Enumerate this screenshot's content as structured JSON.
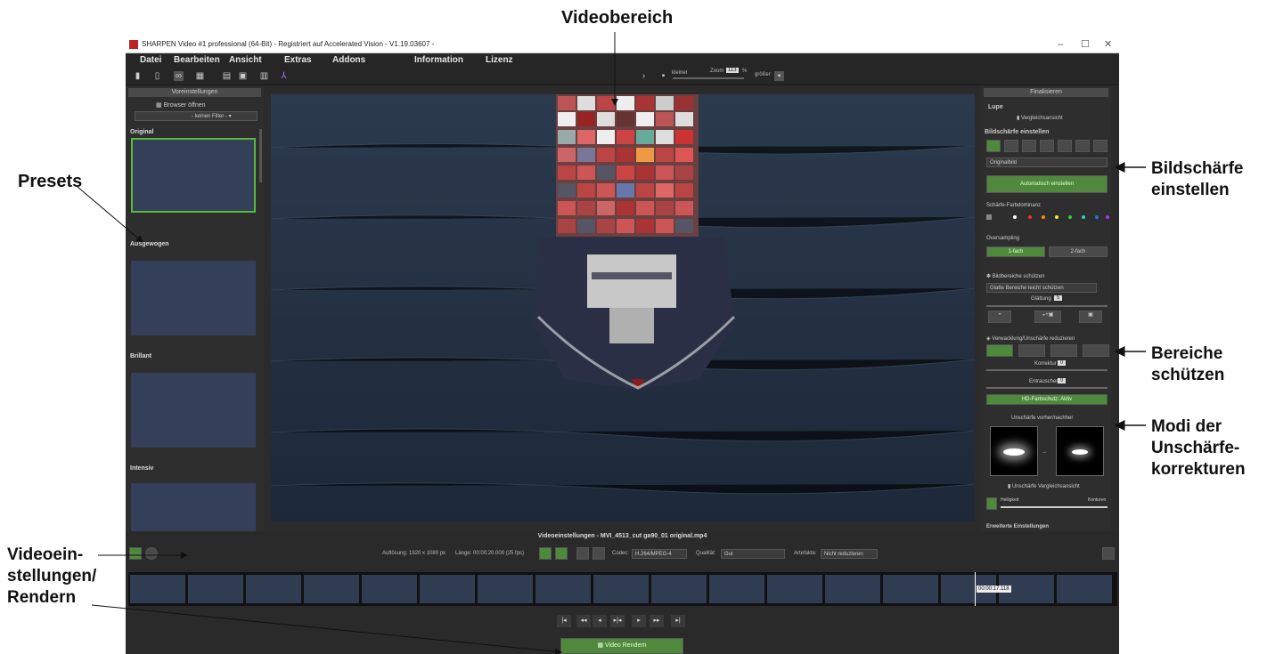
{
  "annotations": {
    "videobereich": "Videobereich",
    "presets": "Presets",
    "bildschaerfe_1": "Bildschärfe",
    "bildschaerfe_2": "einstellen",
    "bereiche_1": "Bereiche",
    "bereiche_2": "schützen",
    "modi_1": "Modi der",
    "modi_2": "Unschärfe-",
    "modi_3": "korrekturen",
    "video_1": "Videoein-",
    "video_2": "stellungen/",
    "video_3": "Rendern"
  },
  "window": {
    "title": "SHARPEN Video #1 professional (64-Bit) - Registriert auf Accelerated Vision - V1.19.03607 -",
    "minimize": "–",
    "maximize": "☐",
    "close": "✕"
  },
  "menu": [
    "Datei",
    "Bearbeiten",
    "Ansicht",
    "Extras",
    "Addons",
    "Information",
    "Lizenz"
  ],
  "toolbar": {
    "zoom_small": "kleiner",
    "zoom_label": "Zoom",
    "zoom_value": "113",
    "zoom_unit": "%",
    "zoom_big": "größer"
  },
  "left_panel": {
    "header": "Voreinstellungen",
    "browser_button": "Browser öffnen",
    "filter": "- keinen Filter -",
    "presets": [
      "Original",
      "Ausgewogen",
      "Brillant",
      "Intensiv"
    ]
  },
  "right_panel": {
    "header": "Finalisieren",
    "lupe": "Lupe",
    "vergleichsansicht": "Vergleichsansicht",
    "bildschaerfe": "Bildschärfe einstellen",
    "originalbild": "Originalbild",
    "auto_button": "Automatisch einstellen",
    "farbdominanz": "Schärfe-Farbdominanz",
    "oversampling": "Oversampling",
    "os_1fach": "1-fach",
    "os_2fach": "2-fach",
    "bildbereiche": "Bildbereiche schützen",
    "glatte": "Glatte Bereiche leicht schützen",
    "glaettung": "Glättung",
    "glaettung_val": "5",
    "verwacklung": "Verwacklung/Unschärfe reduzieren",
    "korrektur": "Korrektur",
    "korrektur_val": "0",
    "entrauschen": "Entrauschen",
    "entrauschen_val": "0",
    "hd_farbschutz": "HD-Farbschutz: Aktiv",
    "unschaerfe_vn": "Unschärfe vorher/nachher",
    "unschaerfe_vgl": "Unschärfe Vergleichsansicht",
    "helligkeit": "Helligkeit",
    "konturen": "Konturen",
    "erweitert": "Erweiterte Einstellungen",
    "percent": "%"
  },
  "bottom": {
    "title": "Videoeinstellungen - MVI_4513_cut ga90_01 original.mp4",
    "aufloesung": "Auflösung: 1920 x 1080 px",
    "laenge": "Länge: 00:00:20.000 (25 fps)",
    "codec_label": "Codec:",
    "codec": "H.264/MPEG-4",
    "qualitaet_label": "Qualität:",
    "qualitaet": "Gut",
    "artefakte_label": "Artefakte:",
    "artefakte": "Nicht reduzieren",
    "timecode": "00:00:17.118",
    "render_button": "Video Rendern"
  },
  "colors": {
    "accent_green": "#5cb83b",
    "button_green": "#4f8a3c",
    "panel_dark": "#2e2e2e"
  }
}
